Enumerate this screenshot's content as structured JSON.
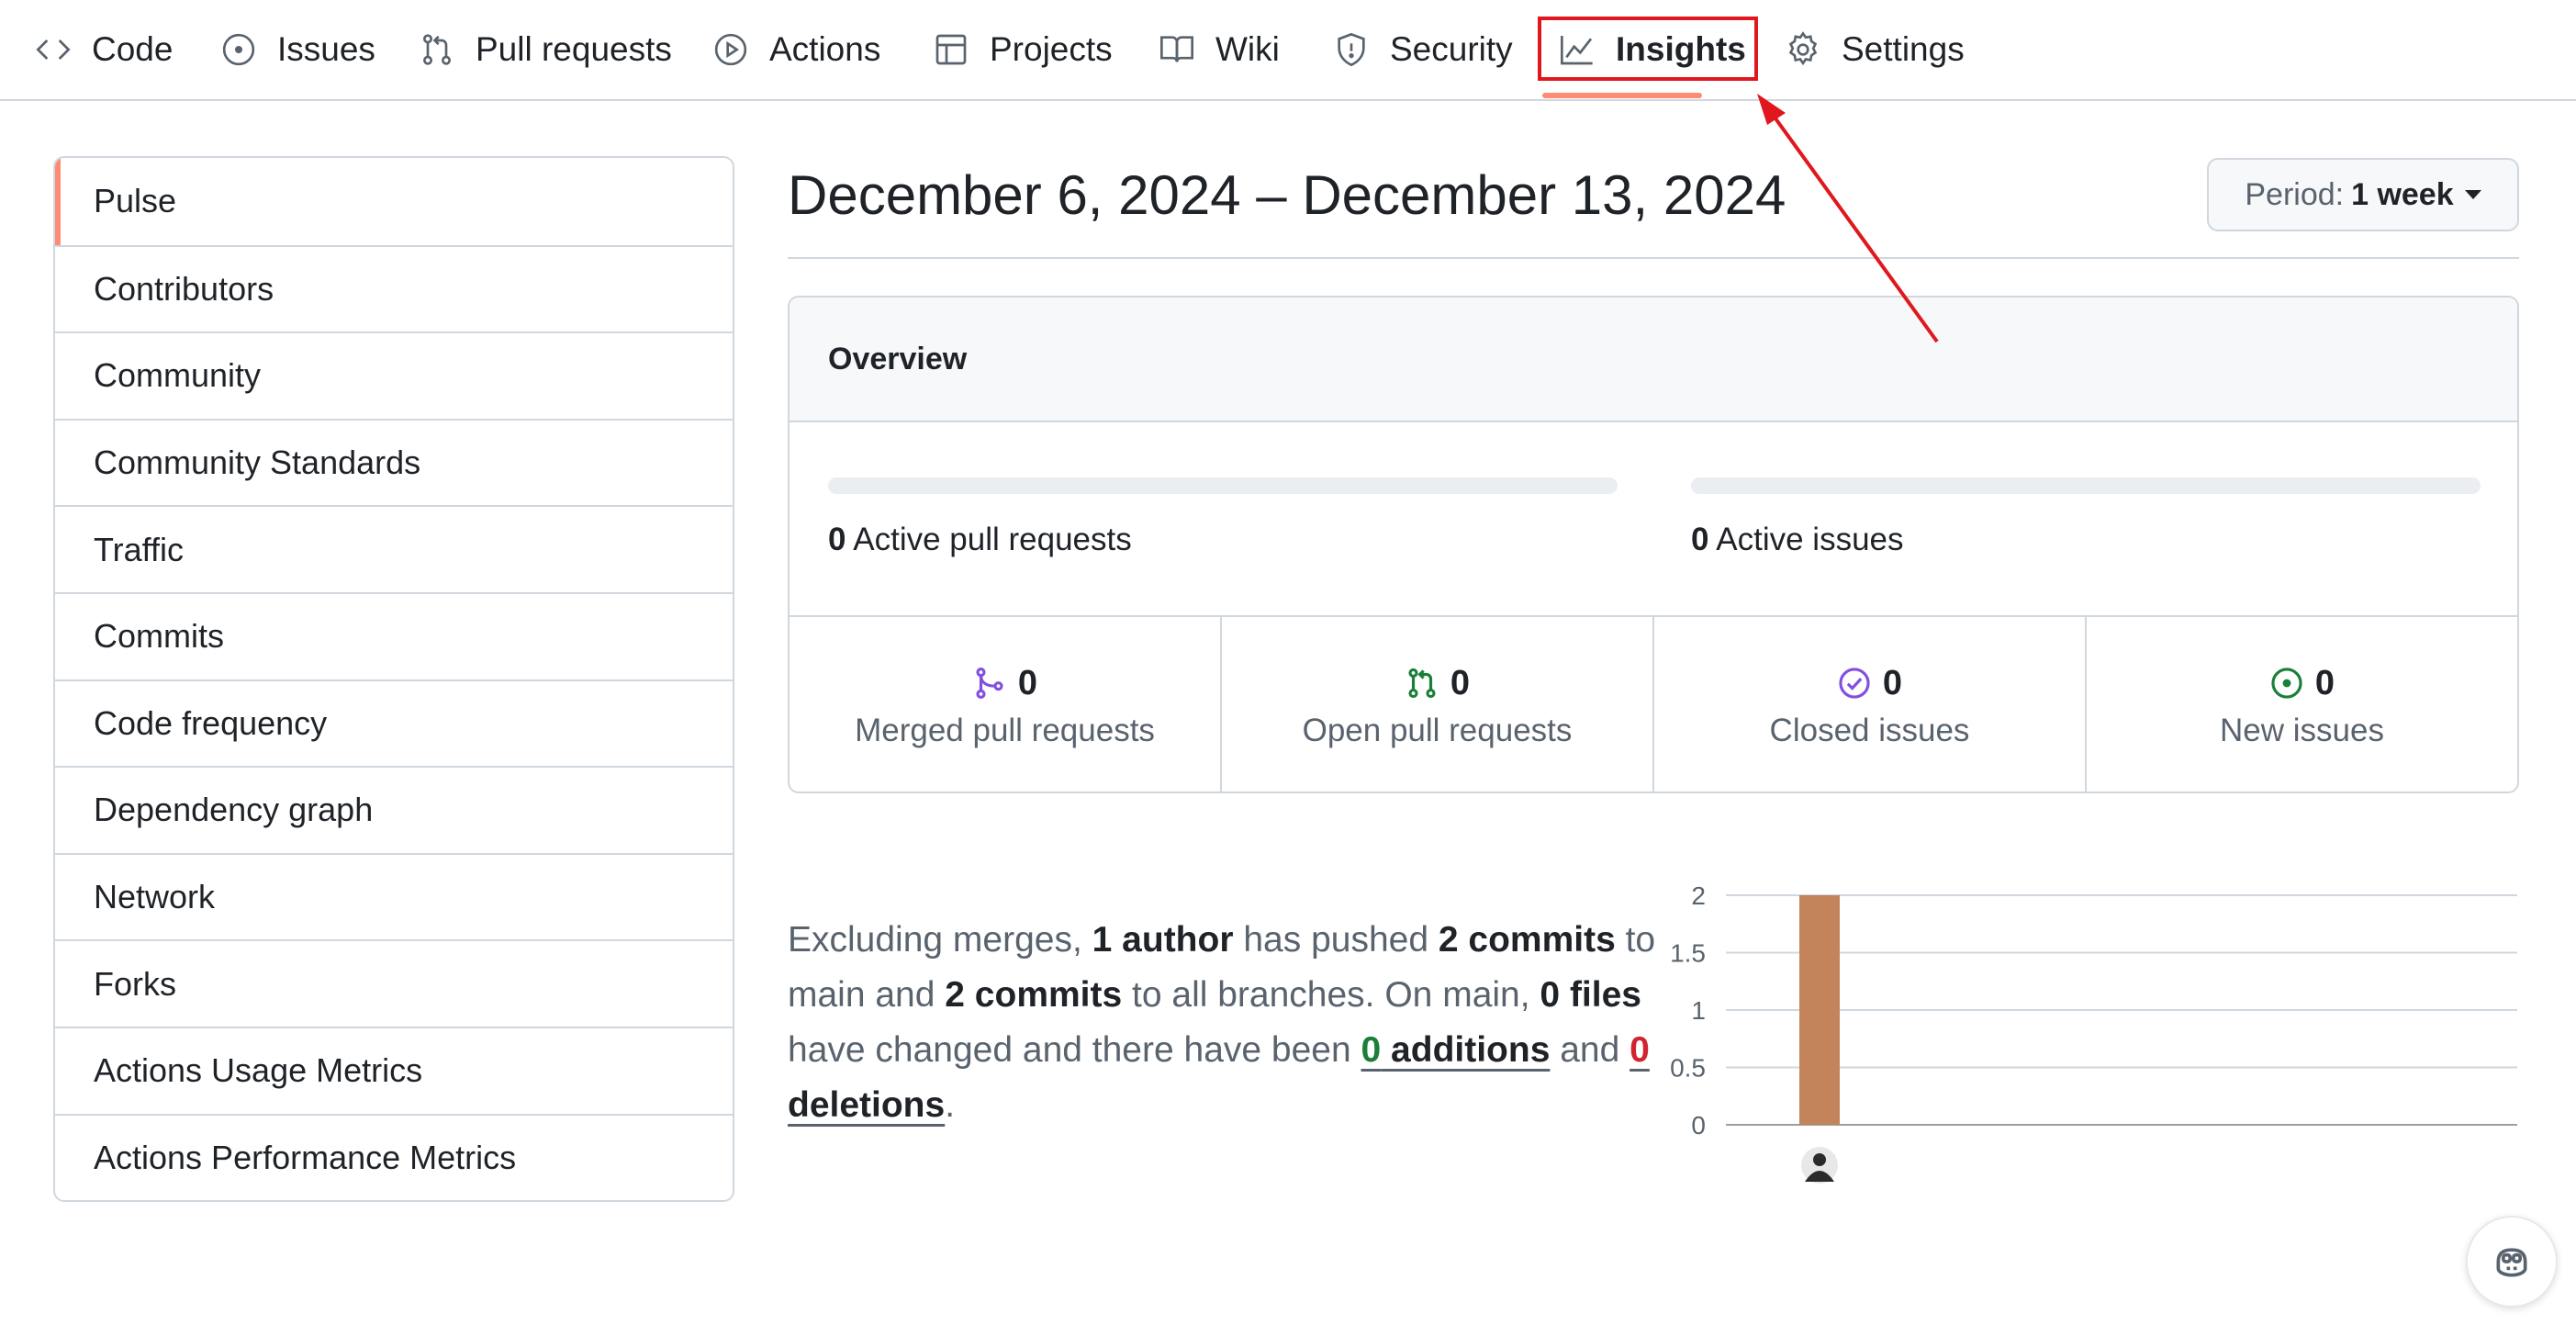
{
  "nav": {
    "tabs": [
      {
        "label": "Code",
        "icon": "code-icon"
      },
      {
        "label": "Issues",
        "icon": "issue-opened-icon"
      },
      {
        "label": "Pull requests",
        "icon": "git-pull-request-icon"
      },
      {
        "label": "Actions",
        "icon": "play-icon"
      },
      {
        "label": "Projects",
        "icon": "table-icon"
      },
      {
        "label": "Wiki",
        "icon": "book-icon"
      },
      {
        "label": "Security",
        "icon": "shield-icon"
      },
      {
        "label": "Insights",
        "icon": "graph-icon",
        "selected": true
      },
      {
        "label": "Settings",
        "icon": "gear-icon"
      }
    ]
  },
  "sidebar": {
    "items": [
      {
        "label": "Pulse",
        "selected": true
      },
      {
        "label": "Contributors"
      },
      {
        "label": "Community"
      },
      {
        "label": "Community Standards"
      },
      {
        "label": "Traffic"
      },
      {
        "label": "Commits"
      },
      {
        "label": "Code frequency"
      },
      {
        "label": "Dependency graph"
      },
      {
        "label": "Network"
      },
      {
        "label": "Forks"
      },
      {
        "label": "Actions Usage Metrics"
      },
      {
        "label": "Actions Performance Metrics"
      }
    ]
  },
  "main": {
    "date_range": "December 6, 2024 – December 13, 2024",
    "period": {
      "label": "Period:",
      "value": "1 week"
    },
    "overview": {
      "title": "Overview",
      "active_prs": {
        "count": "0",
        "label": "Active pull requests",
        "fill": 0
      },
      "active_issues": {
        "count": "0",
        "label": "Active issues",
        "fill": 0
      },
      "stats": [
        {
          "count": "0",
          "label": "Merged pull requests",
          "icon": "git-merge-icon",
          "color": "#8250df"
        },
        {
          "count": "0",
          "label": "Open pull requests",
          "icon": "git-pull-request-icon",
          "color": "#1a7f37"
        },
        {
          "count": "0",
          "label": "Closed issues",
          "icon": "issue-closed-icon",
          "color": "#8250df"
        },
        {
          "count": "0",
          "label": "New issues",
          "icon": "issue-opened-icon",
          "color": "#1a7f37"
        }
      ]
    },
    "summary": {
      "p1": "Excluding merges, ",
      "authors": "1 author",
      "p2": " has pushed ",
      "commits_main": "2 commits",
      "p3": " to main and ",
      "commits_all": "2 commits",
      "p4": " to all branches. On main, ",
      "files": "0 files",
      "p5": " have changed and there have been ",
      "additions_num": "0",
      "additions_word": " additions",
      "p6": " and ",
      "deletions_num": "0",
      "deletions_word": " deletions",
      "p7": "."
    }
  },
  "chart_data": {
    "type": "bar",
    "categories": [
      "author"
    ],
    "values": [
      2
    ],
    "ylim": [
      0,
      2
    ],
    "yticks": [
      "0",
      "0.5",
      "1",
      "1.5",
      "2"
    ],
    "grid": true,
    "bar_color": "#c3845b"
  },
  "colors": {
    "accent_underline": "#fd8c73",
    "annotation_red": "#e0171d",
    "merged_purple": "#8250df",
    "open_green": "#1a7f37",
    "deletions_red": "#d1242f"
  }
}
